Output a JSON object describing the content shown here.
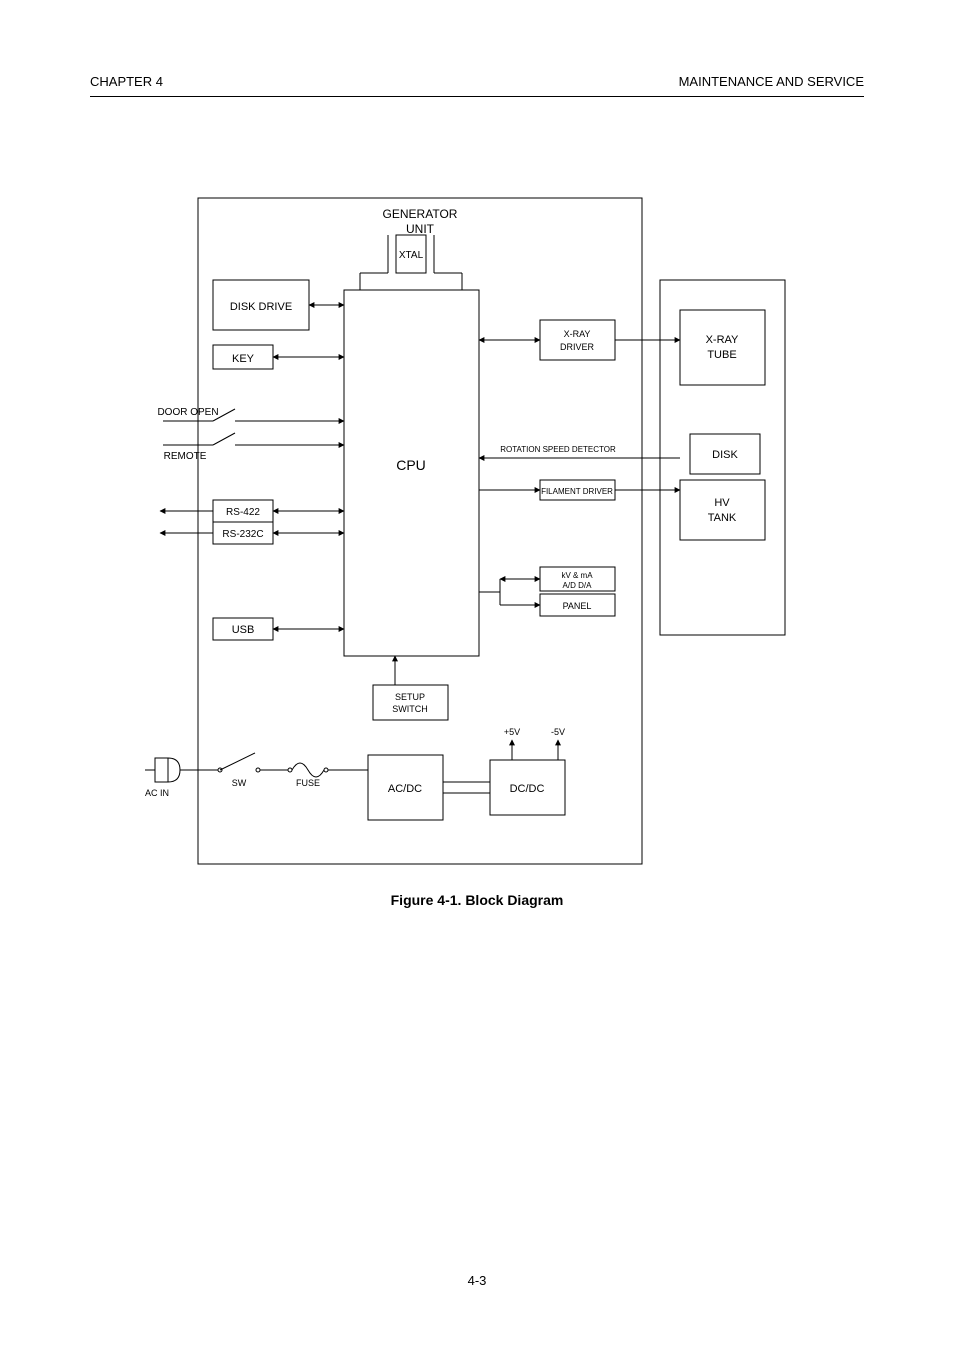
{
  "header": {
    "chapter_label": "CHAPTER 4",
    "chapter_title": "MAINTENANCE AND SERVICE",
    "page_number": "4-3"
  },
  "figure": {
    "caption_prefix": "Figure 4-1.",
    "caption_text": "Block Diagram",
    "title_line1": "GENERATOR",
    "title_line2": "UNIT",
    "cpu": "CPU",
    "xtal": "XTAL",
    "disk_drive": "DISK DRIVE",
    "key": "KEY",
    "door_open": "DOOR OPEN",
    "remote": "REMOTE",
    "rs422": "RS-422",
    "rs232c": "RS-232C",
    "usb": "USB",
    "panel_label": "PANEL",
    "setup_switch": "SETUP SWITCH",
    "ac_in": "AC IN",
    "sw": "SW",
    "fuse": "FUSE",
    "ac_dc": "AC/DC",
    "dc_dc": "DC/DC",
    "plus5v": "+5V",
    "minus5v": "-5V",
    "xray_driver": "X-RAY DRIVER",
    "rotation_speed_detector": "ROTATION SPEED DETECTOR",
    "filament_driver": "FILAMENT DRIVER",
    "kv_ma_line1": "kV & mA",
    "kv_ma_line2": "A/D D/A",
    "xray_tube_line1": "X-RAY",
    "xray_tube_line2": "TUBE",
    "disk": "DISK",
    "hv_tank_line1": "HV",
    "hv_tank_line2": "TANK"
  }
}
